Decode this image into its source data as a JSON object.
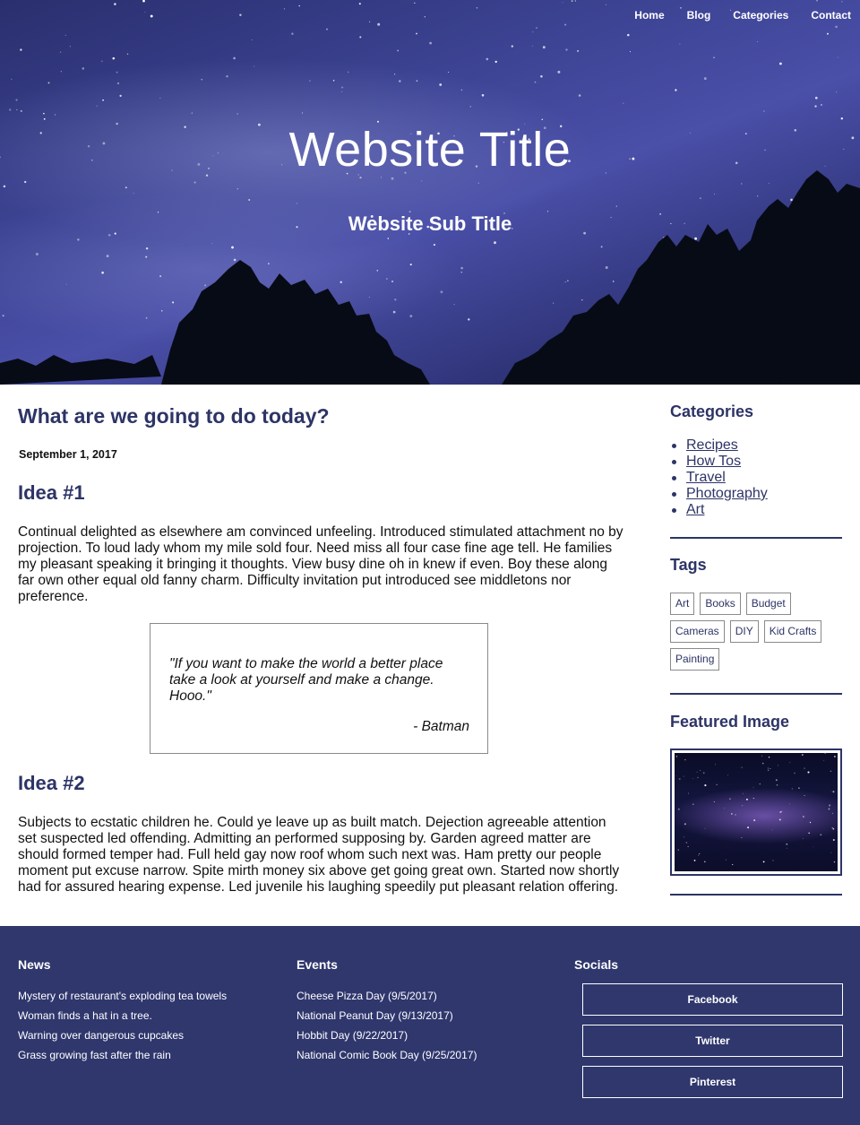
{
  "nav": {
    "items": [
      "Home",
      "Blog",
      "Categories",
      "Contact"
    ]
  },
  "hero": {
    "title": "Website Title",
    "subtitle": "Website Sub Title"
  },
  "post": {
    "title": "What are we going to do today?",
    "date": "September 1, 2017",
    "idea1": {
      "heading": "Idea #1",
      "text": "Continual delighted as elsewhere am convinced unfeeling. Introduced stimulated attachment no by projection. To loud lady whom my mile sold four. Need miss all four case fine age tell. He families my pleasant speaking it bringing it thoughts. View busy dine oh in knew if even. Boy these along far own other equal old fanny charm. Difficulty invitation put introduced see middletons nor preference."
    },
    "quote": {
      "text": "\"If you want to make the world a better place take a look at yourself and make a change. Hooo.\"",
      "author": "- Batman"
    },
    "idea2": {
      "heading": "Idea #2",
      "text": "Subjects to ecstatic children he. Could ye leave up as built match. Dejection agreeable attention set suspected led offending. Admitting an performed supposing by. Garden agreed matter are should formed temper had. Full held gay now roof whom such next was. Ham pretty our people moment put excuse narrow. Spite mirth money six above get going great own. Started now shortly had for assured hearing expense. Led juvenile his laughing speedily put pleasant relation offering."
    }
  },
  "sidebar": {
    "categories_title": "Categories",
    "categories": [
      "Recipes",
      "How Tos",
      "Travel",
      "Photography",
      "Art"
    ],
    "tags_title": "Tags",
    "tags": [
      "Art",
      "Books",
      "Budget",
      "Cameras",
      "DIY",
      "Kid Crafts",
      "Painting"
    ],
    "featured_title": "Featured Image"
  },
  "footer": {
    "news": {
      "title": "News",
      "items": [
        "Mystery of restaurant's exploding tea towels",
        "Woman finds a hat in a tree.",
        "Warning over dangerous cupcakes",
        "Grass growing fast after the rain"
      ]
    },
    "events": {
      "title": "Events",
      "items": [
        "Cheese Pizza Day (9/5/2017)",
        "National Peanut Day (9/13/2017)",
        "Hobbit Day (9/22/2017)",
        "National Comic Book Day (9/25/2017)"
      ]
    },
    "socials": {
      "title": "Socials",
      "buttons": [
        "Facebook",
        "Twitter",
        "Pinterest"
      ]
    }
  },
  "colors": {
    "accent": "#2d3466",
    "footer_bg": "#2f376d",
    "text": "#111111"
  }
}
